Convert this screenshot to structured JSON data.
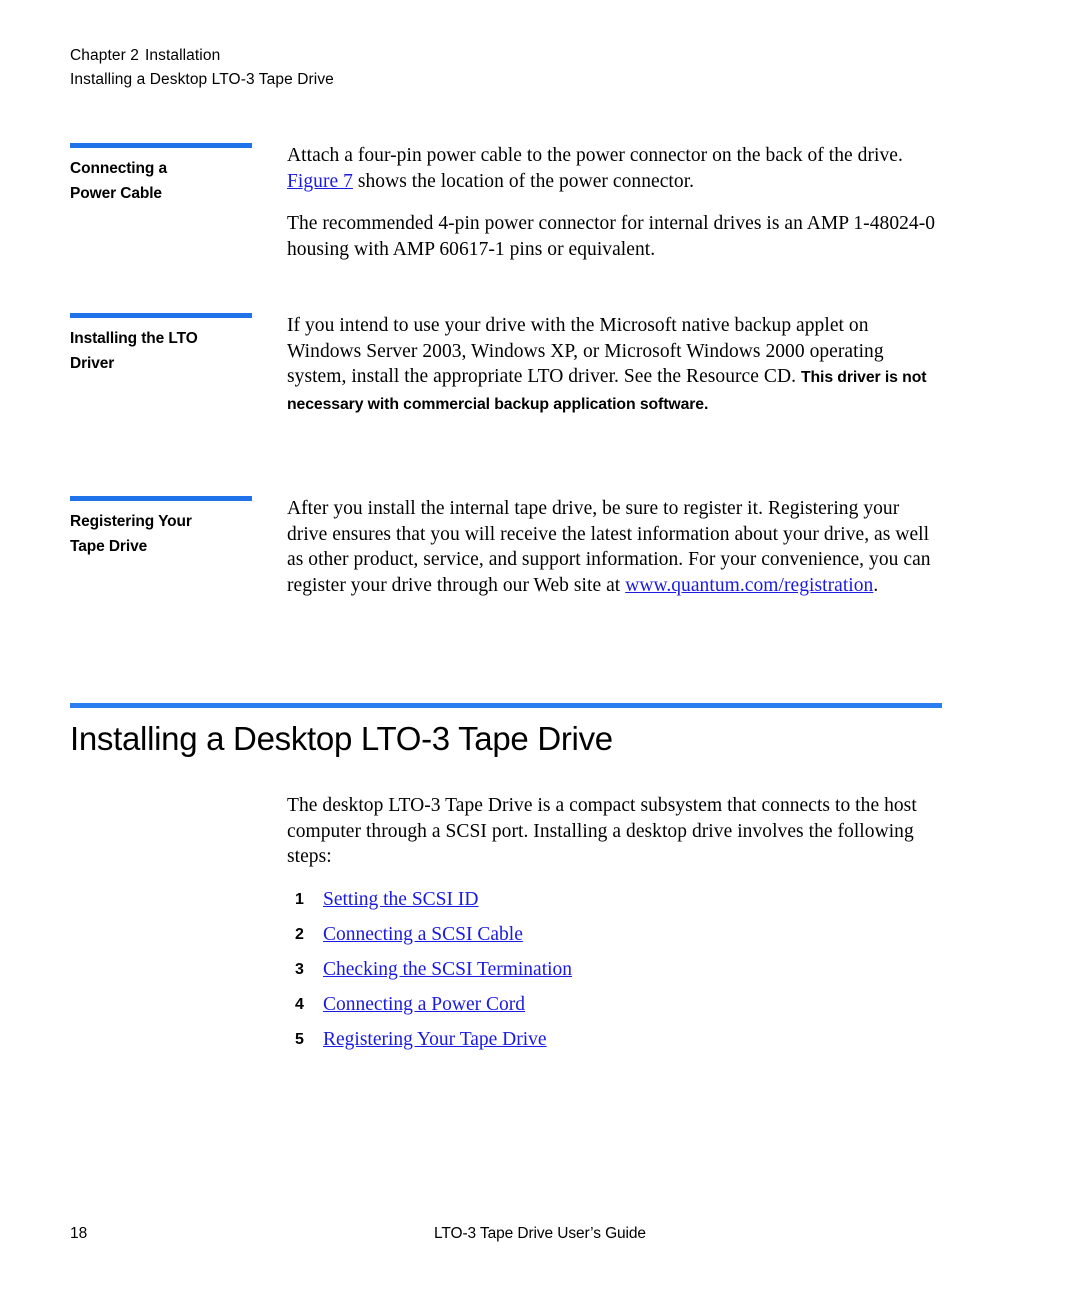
{
  "header": {
    "chapter_label": "Chapter 2",
    "chapter_title": "Installation",
    "running_title": "Installing a Desktop LTO-3 Tape Drive"
  },
  "colors": {
    "rule_blue": "#2a7ef0",
    "link_blue": "#1a1ae0",
    "text_black": "#000000",
    "page_background": "#ffffff"
  },
  "sections": [
    {
      "heading_line1": "Connecting a",
      "heading_line2": "Power Cable",
      "paragraph1_part1": "Attach a four-pin power cable to the power connector on the back of the drive. ",
      "paragraph1_link": "Figure 7",
      "paragraph1_part2": " shows the location of the power connector.",
      "paragraph2": "The recommended 4-pin power connector for internal drives is an AMP 1-48024-0 housing with AMP 60617-1 pins or equivalent."
    },
    {
      "heading_line1": "Installing the LTO",
      "heading_line2": "Driver",
      "paragraph1_regular": "If you intend to use your drive with the Microsoft native backup applet on Windows Server 2003, Windows XP, or Microsoft Windows 2000 operating system, install the appropriate LTO driver. See the Resource CD. ",
      "paragraph1_bold": "This driver is not necessary with commercial backup application software."
    },
    {
      "heading_line1": "Registering Your",
      "heading_line2": "Tape Drive",
      "paragraph1_part1": "After you install the internal tape drive, be sure to register it. Registering your drive ensures that you will receive the latest information about your drive, as well as other product, service, and support information. For your convenience, you can register your drive through our Web site at ",
      "paragraph1_link": "www.quantum.com/registration",
      "paragraph1_part2": "."
    }
  ],
  "chapter_section": {
    "title": "Installing a Desktop LTO-3 Tape Drive",
    "intro": "The desktop LTO-3 Tape Drive is a compact subsystem that connects to the host computer through a SCSI port. Installing a desktop drive involves the following steps:",
    "steps": [
      {
        "number": "1",
        "label": "Setting the SCSI ID"
      },
      {
        "number": "2",
        "label": "Connecting a SCSI Cable"
      },
      {
        "number": "3",
        "label": "Checking the SCSI Termination"
      },
      {
        "number": "4",
        "label": "Connecting a Power Cord"
      },
      {
        "number": "5",
        "label": "Registering Your Tape Drive"
      }
    ]
  },
  "footer": {
    "page_number": "18",
    "document_title": "LTO-3 Tape Drive User’s Guide"
  }
}
